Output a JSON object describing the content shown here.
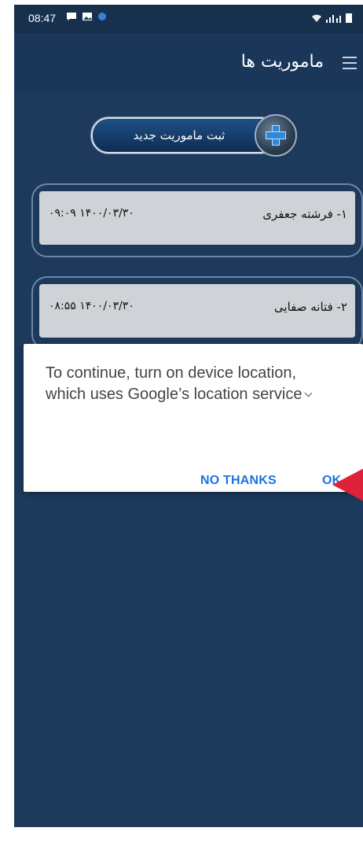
{
  "status_bar": {
    "time": "08:47"
  },
  "app_bar": {
    "title": "ماموریت ها"
  },
  "new_mission_button": {
    "label": "ثبت ماموریت جدید"
  },
  "missions": [
    {
      "name": "۱- فرشته جعفری",
      "datetime": "۱۴۰۰/۰۳/۳۰ ۰۹:۰۹"
    },
    {
      "name": "۲- فتانه صفایی",
      "datetime": "۱۴۰۰/۰۳/۳۰ ۰۸:۵۵"
    }
  ],
  "dialog": {
    "message": "To continue, turn on device location, which uses Google’s location service",
    "no_thanks_label": "NO THANKS",
    "ok_label": "OK"
  },
  "colors": {
    "background": "#1d3a5c",
    "app_bar": "#1a375a",
    "card": "#cfd3d8",
    "dialog_button": "#1a73e8",
    "pointer": "#e0213a"
  },
  "icons": [
    "menu-icon",
    "plus-icon",
    "chevron-down-icon",
    "arrow-pointer-icon",
    "wifi-icon",
    "signal-icon",
    "battery-icon",
    "message-icon",
    "image-icon"
  ]
}
